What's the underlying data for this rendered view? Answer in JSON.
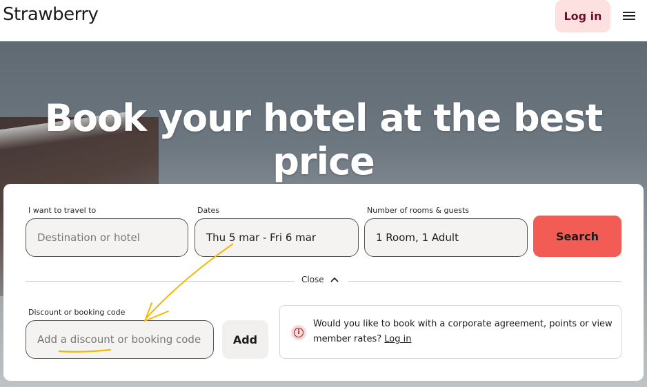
{
  "header": {
    "logo": "Strawberry",
    "login_label": "Log in",
    "menu_icon": "hamburger-menu-icon"
  },
  "hero": {
    "title": "Book your hotel at the best price"
  },
  "search": {
    "destination": {
      "label": "I want to travel to",
      "placeholder": "Destination or hotel"
    },
    "dates": {
      "label": "Dates",
      "value": "Thu 5 mar - Fri 6 mar"
    },
    "guests": {
      "label": "Number of rooms & guests",
      "value": "1 Room, 1 Adult"
    },
    "search_label": "Search",
    "close_label": "Close",
    "discount": {
      "label": "Discount or booking code",
      "placeholder": "Add a discount or booking code"
    },
    "add_label": "Add",
    "info": {
      "text": "Would you like to book with a corporate agreement, points or view member rates?",
      "link": "Log in"
    }
  },
  "colors": {
    "accent": "#f25c54",
    "login_bg": "#fde0e0",
    "annotation": "#f5b800"
  }
}
